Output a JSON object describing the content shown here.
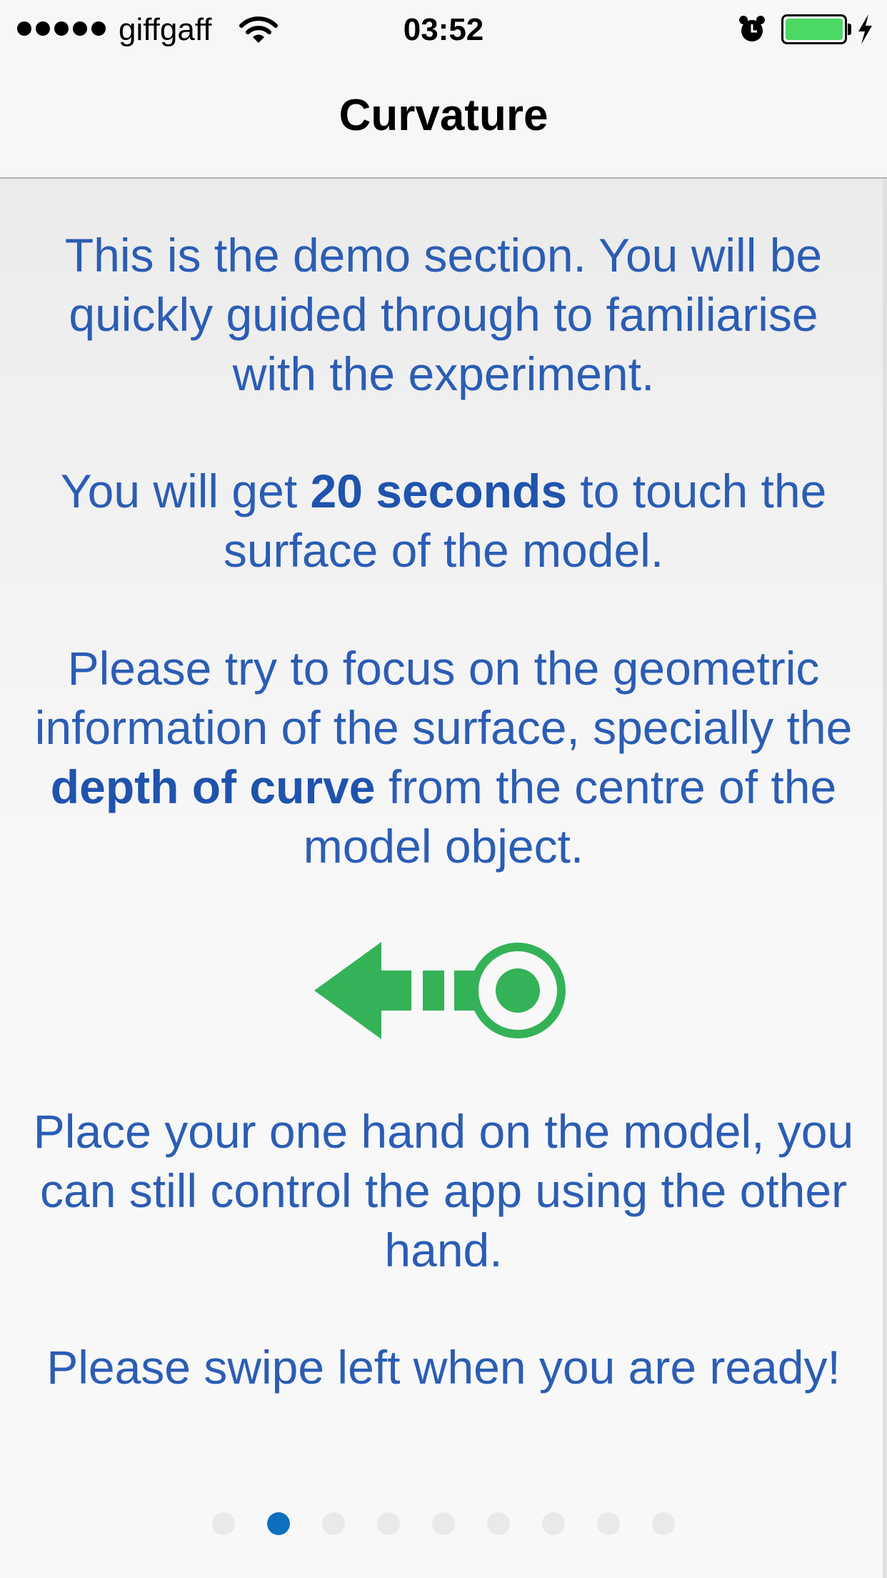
{
  "status_bar": {
    "carrier": "giffgaff",
    "time": "03:52",
    "signal_bars": 5,
    "battery_level": 1.0,
    "charging": true,
    "alarm": true,
    "icons": [
      "signal-dots-icon",
      "wifi-icon",
      "alarm-clock-icon",
      "battery-icon",
      "charging-bolt-icon"
    ]
  },
  "nav": {
    "title": "Curvature"
  },
  "content": {
    "p1": "This is the demo section. You will be quickly guided through to familiarise with the experiment.",
    "p2_before": "You will get ",
    "p2_bold": "20 seconds",
    "p2_after": " to touch the surface of the model.",
    "p3_before": "Please try to focus on the geometric information of the surface, specially the ",
    "p3_bold": "depth of curve",
    "p3_after": " from the centre of the model object.",
    "swipe_icon": "swipe-left-arrow-icon",
    "p4": "Place your one hand on the model, you can still control the app using the other hand.",
    "p5": "Please swipe left when you are ready!"
  },
  "pagination": {
    "total_pages": 9,
    "current_page": 2
  },
  "colors": {
    "text": "#2b5db4",
    "accent_green": "#34b257",
    "active_dot": "#0d6fbf",
    "inactive_dot": "#e9e9e9",
    "battery": "#4cd964"
  }
}
